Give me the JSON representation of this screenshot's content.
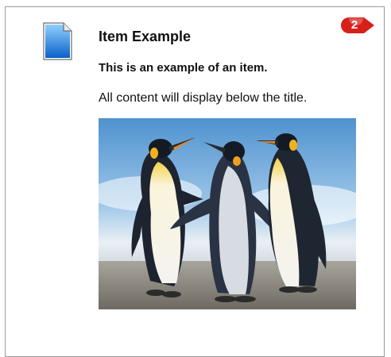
{
  "item": {
    "title": "Item Example",
    "subtitle": "This is an example of an item.",
    "body": "All content will display below the title."
  },
  "badge": {
    "count": "2",
    "color": "#d8201a"
  },
  "icons": {
    "document": "document-icon",
    "image": "penguins-photo"
  }
}
